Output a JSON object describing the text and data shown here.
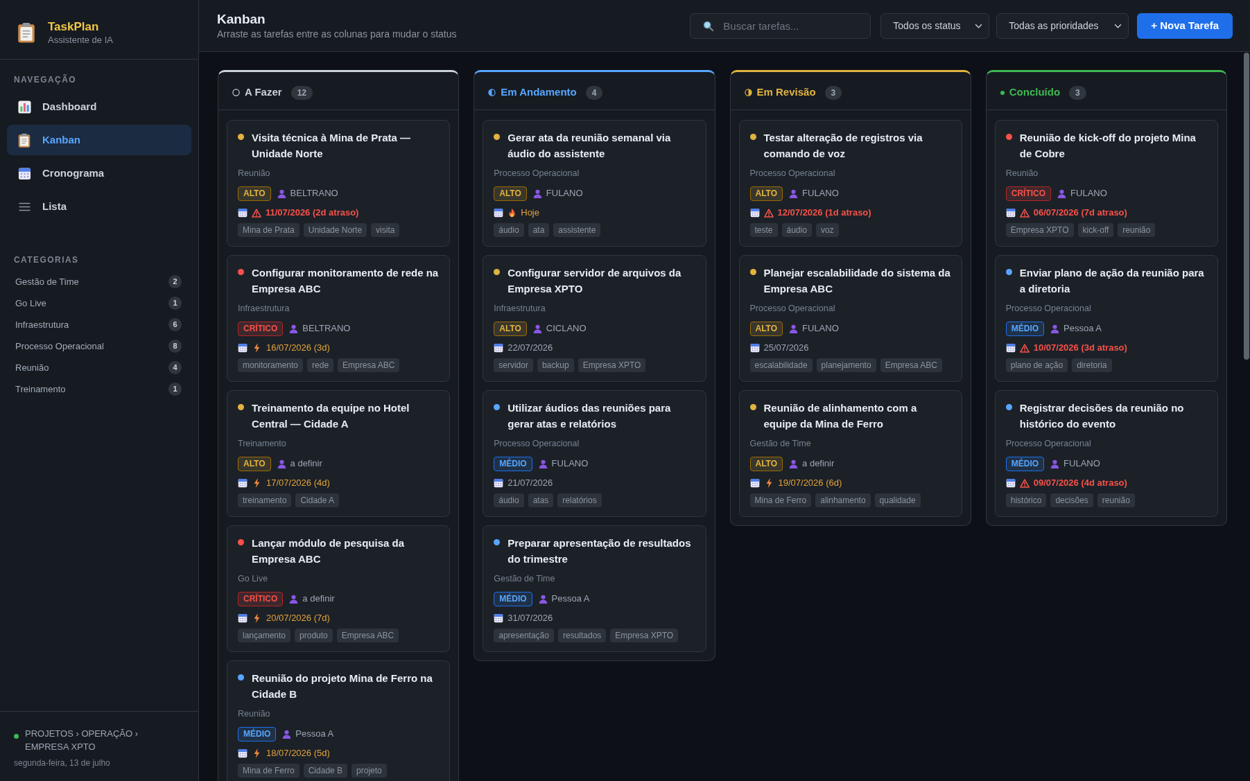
{
  "sidebar": {
    "app_title": "TaskPlan",
    "app_subtitle": "Assistente de IA",
    "nav_heading": "NAVEGAÇÃO",
    "nav": [
      {
        "kind": "chart",
        "label": "Dashboard",
        "selected": false
      },
      {
        "kind": "clipboard",
        "label": "Kanban",
        "selected": true
      },
      {
        "kind": "calendar",
        "label": "Cronograma",
        "selected": false
      },
      {
        "kind": "list",
        "label": "Lista",
        "selected": false
      }
    ],
    "categories_heading": "CATEGORIAS",
    "categories": [
      {
        "name": "Gestão de Time",
        "count": "2"
      },
      {
        "name": "Go Live",
        "count": "1"
      },
      {
        "name": "Infraestrutura",
        "count": "6"
      },
      {
        "name": "Processo Operacional",
        "count": "8"
      },
      {
        "name": "Reunião",
        "count": "4"
      },
      {
        "name": "Treinamento",
        "count": "1"
      }
    ],
    "footer": {
      "breadcrumb": "PROJETOS › OPERAÇÃO › EMPRESA XPTO",
      "date": "segunda-feira, 13 de julho"
    }
  },
  "header": {
    "title": "Kanban",
    "subtitle": "Arraste as tarefas entre as colunas para mudar o status",
    "search": {
      "placeholder": "Buscar tarefas..."
    },
    "filters": [
      {
        "value": "Todos os status"
      },
      {
        "value": "Todas as prioridades"
      }
    ],
    "new_button": "+ Nova Tarefa"
  },
  "columns": [
    {
      "kind": "todo",
      "title": "A Fazer",
      "count": "12",
      "color": "#c9d1d9",
      "cards": [
        {
          "title": "Visita técnica à Mina de Prata — Unidade Norte",
          "category": "Reunião",
          "priority": {
            "kind": "high",
            "label": "ALTO"
          },
          "assignee": "BELTRANO",
          "due": {
            "kind": "overdue",
            "text": "11/07/2026 (2d atraso)"
          },
          "tags": [
            "Mina de Prata",
            "Unidade Norte",
            "visita"
          ]
        },
        {
          "title": "Configurar monitoramento de rede na Empresa ABC",
          "category": "Infraestrutura",
          "priority": {
            "kind": "critical",
            "label": "CRÍTICO"
          },
          "assignee": "BELTRANO",
          "due": {
            "kind": "soon",
            "text": "16/07/2026 (3d)"
          },
          "tags": [
            "monitoramento",
            "rede",
            "Empresa ABC"
          ]
        },
        {
          "title": "Treinamento da equipe no Hotel Central — Cidade A",
          "category": "Treinamento",
          "priority": {
            "kind": "high",
            "label": "ALTO"
          },
          "assignee": "a definir",
          "due": {
            "kind": "soon",
            "text": "17/07/2026 (4d)"
          },
          "tags": [
            "treinamento",
            "Cidade A"
          ]
        },
        {
          "title": "Lançar módulo de pesquisa da Empresa ABC",
          "category": "Go Live",
          "priority": {
            "kind": "critical",
            "label": "CRÍTICO"
          },
          "assignee": "a definir",
          "due": {
            "kind": "soon",
            "text": "20/07/2026 (7d)"
          },
          "tags": [
            "lançamento",
            "produto",
            "Empresa ABC"
          ]
        },
        {
          "title": "Reunião do projeto Mina de Ferro na Cidade B",
          "category": "Reunião",
          "priority": {
            "kind": "medium",
            "label": "MÉDIO"
          },
          "assignee": "Pessoa A",
          "due": {
            "kind": "soon",
            "text": "18/07/2026 (5d)"
          },
          "tags": [
            "Mina de Ferro",
            "Cidade B",
            "projeto"
          ]
        }
      ]
    },
    {
      "kind": "progress",
      "title": "Em Andamento",
      "count": "4",
      "color": "#58a6ff",
      "cards": [
        {
          "title": "Gerar ata da reunião semanal via áudio do assistente",
          "category": "Processo Operacional",
          "priority": {
            "kind": "high",
            "label": "ALTO"
          },
          "assignee": "FULANO",
          "due": {
            "kind": "today",
            "text": "Hoje"
          },
          "tags": [
            "áudio",
            "ata",
            "assistente"
          ]
        },
        {
          "title": "Configurar servidor de arquivos da Empresa XPTO",
          "category": "Infraestrutura",
          "priority": {
            "kind": "high",
            "label": "ALTO"
          },
          "assignee": "CICLANO",
          "due": {
            "kind": "normal",
            "text": "22/07/2026"
          },
          "tags": [
            "servidor",
            "backup",
            "Empresa XPTO"
          ]
        },
        {
          "title": "Utilizar áudios das reuniões para gerar atas e relatórios",
          "category": "Processo Operacional",
          "priority": {
            "kind": "medium",
            "label": "MÉDIO"
          },
          "assignee": "FULANO",
          "due": {
            "kind": "normal",
            "text": "21/07/2026"
          },
          "tags": [
            "áudio",
            "atas",
            "relatórios"
          ]
        },
        {
          "title": "Preparar apresentação de resultados do trimestre",
          "category": "Gestão de Time",
          "priority": {
            "kind": "medium",
            "label": "MÉDIO"
          },
          "assignee": "Pessoa A",
          "due": {
            "kind": "normal",
            "text": "31/07/2026"
          },
          "tags": [
            "apresentação",
            "resultados",
            "Empresa XPTO"
          ]
        }
      ]
    },
    {
      "kind": "review",
      "title": "Em Revisão",
      "count": "3",
      "color": "#e3b341",
      "cards": [
        {
          "title": "Testar alteração de registros via comando de voz",
          "category": "Processo Operacional",
          "priority": {
            "kind": "high",
            "label": "ALTO"
          },
          "assignee": "FULANO",
          "due": {
            "kind": "overdue",
            "text": "12/07/2026 (1d atraso)"
          },
          "tags": [
            "teste",
            "áudio",
            "voz"
          ]
        },
        {
          "title": "Planejar escalabilidade do sistema da Empresa ABC",
          "category": "Processo Operacional",
          "priority": {
            "kind": "high",
            "label": "ALTO"
          },
          "assignee": "FULANO",
          "due": {
            "kind": "normal",
            "text": "25/07/2026"
          },
          "tags": [
            "escalabilidade",
            "planejamento",
            "Empresa ABC"
          ]
        },
        {
          "title": "Reunião de alinhamento com a equipe da Mina de Ferro",
          "category": "Gestão de Time",
          "priority": {
            "kind": "high",
            "label": "ALTO"
          },
          "assignee": "a definir",
          "due": {
            "kind": "soon",
            "text": "19/07/2026 (6d)"
          },
          "tags": [
            "Mina de Ferro",
            "alinhamento",
            "qualidade"
          ]
        }
      ]
    },
    {
      "kind": "done",
      "title": "Concluído",
      "count": "3",
      "color": "#3fb950",
      "cards": [
        {
          "title": "Reunião de kick-off do projeto Mina de Cobre",
          "category": "Reunião",
          "priority": {
            "kind": "critical",
            "label": "CRÍTICO"
          },
          "assignee": "FULANO",
          "due": {
            "kind": "overdue",
            "text": "06/07/2026 (7d atraso)"
          },
          "tags": [
            "Empresa XPTO",
            "kick-off",
            "reunião"
          ]
        },
        {
          "title": "Enviar plano de ação da reunião para a diretoria",
          "category": "Processo Operacional",
          "priority": {
            "kind": "medium",
            "label": "MÉDIO"
          },
          "assignee": "Pessoa A",
          "due": {
            "kind": "overdue",
            "text": "10/07/2026 (3d atraso)"
          },
          "tags": [
            "plano de ação",
            "diretoria"
          ]
        },
        {
          "title": "Registrar decisões da reunião no histórico do evento",
          "category": "Processo Operacional",
          "priority": {
            "kind": "medium",
            "label": "MÉDIO"
          },
          "assignee": "FULANO",
          "due": {
            "kind": "overdue",
            "text": "09/07/2026 (4d atraso)"
          },
          "tags": [
            "histórico",
            "decisões",
            "reunião"
          ]
        }
      ]
    }
  ]
}
